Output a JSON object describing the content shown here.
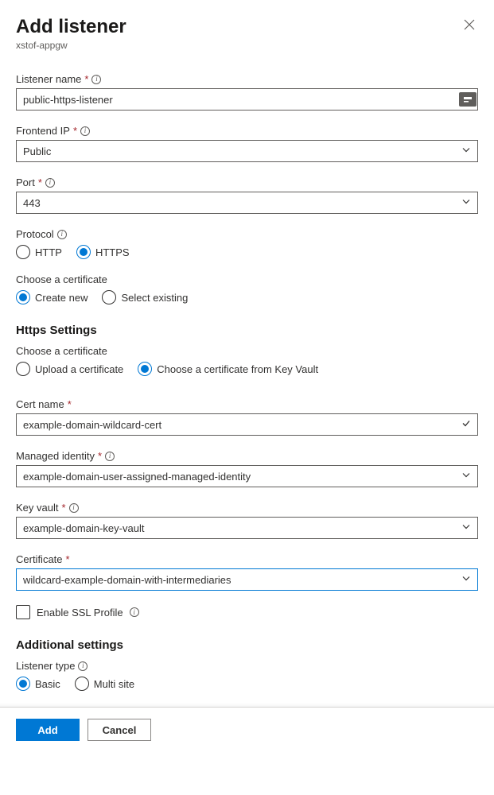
{
  "header": {
    "title": "Add listener",
    "subtitle": "xstof-appgw"
  },
  "listenerName": {
    "label": "Listener name",
    "value": "public-https-listener"
  },
  "frontendIp": {
    "label": "Frontend IP",
    "value": "Public"
  },
  "port": {
    "label": "Port",
    "value": "443"
  },
  "protocol": {
    "label": "Protocol",
    "options": {
      "http": "HTTP",
      "https": "HTTPS"
    }
  },
  "chooseCert1": {
    "label": "Choose a certificate",
    "options": {
      "create": "Create new",
      "select": "Select existing"
    }
  },
  "httpsSettingsTitle": "Https Settings",
  "chooseCert2": {
    "label": "Choose a certificate",
    "options": {
      "upload": "Upload a certificate",
      "kv": "Choose a certificate from Key Vault"
    }
  },
  "certName": {
    "label": "Cert name",
    "value": "example-domain-wildcard-cert"
  },
  "managedIdentity": {
    "label": "Managed identity",
    "value": "example-domain-user-assigned-managed-identity"
  },
  "keyVault": {
    "label": "Key vault",
    "value": "example-domain-key-vault"
  },
  "certificate": {
    "label": "Certificate",
    "value": "wildcard-example-domain-with-intermediaries"
  },
  "sslProfile": {
    "label": "Enable SSL Profile"
  },
  "additionalSettingsTitle": "Additional settings",
  "listenerType": {
    "label": "Listener type",
    "options": {
      "basic": "Basic",
      "multi": "Multi site"
    }
  },
  "buttons": {
    "add": "Add",
    "cancel": "Cancel"
  }
}
